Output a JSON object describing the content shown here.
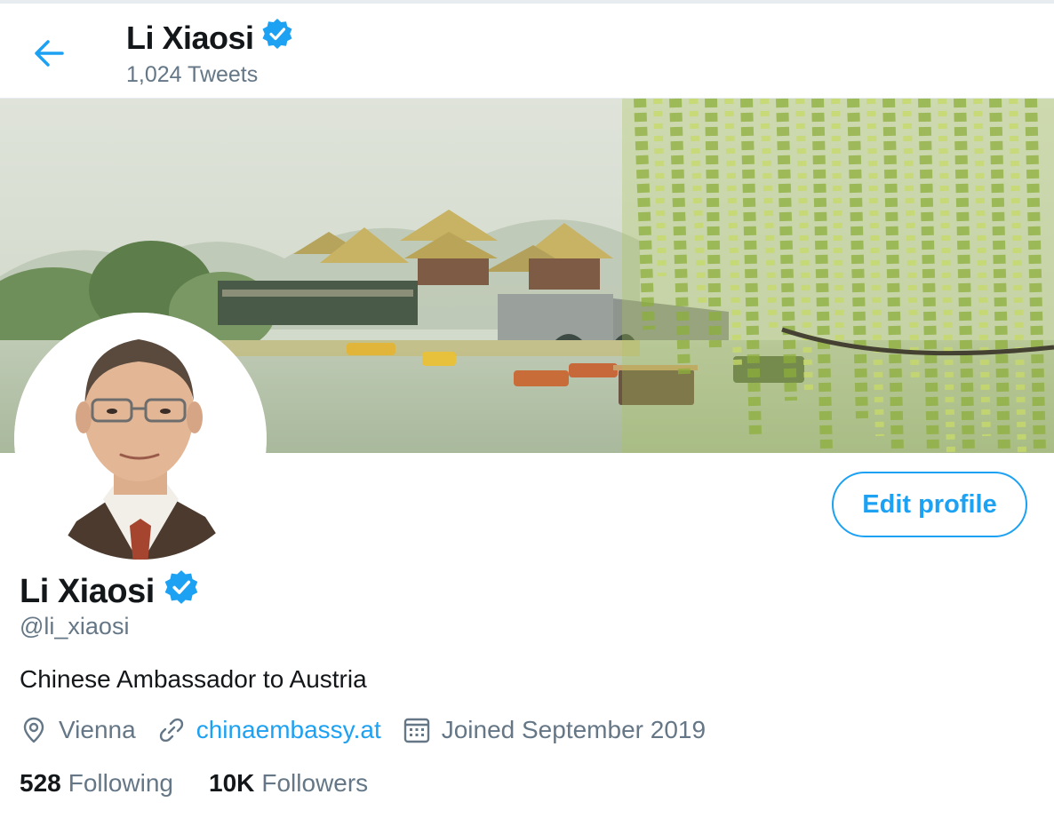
{
  "header": {
    "name": "Li Xiaosi",
    "tweet_count": "1,024 Tweets"
  },
  "profile": {
    "name": "Li Xiaosi",
    "handle": "@li_xiaosi",
    "bio": "Chinese Ambassador to Austria",
    "location": "Vienna",
    "website": "chinaembassy.at",
    "joined": "Joined September 2019",
    "edit_button": "Edit profile"
  },
  "stats": {
    "following_count": "528",
    "following_label": "Following",
    "followers_count": "10K",
    "followers_label": "Followers"
  },
  "icons": {
    "back": "arrow-left-icon",
    "verified": "verified-badge-icon",
    "location": "location-pin-icon",
    "link": "link-icon",
    "calendar": "calendar-icon"
  },
  "colors": {
    "accent": "#1da1f2",
    "secondary_text": "#657786",
    "primary_text": "#14171a"
  }
}
